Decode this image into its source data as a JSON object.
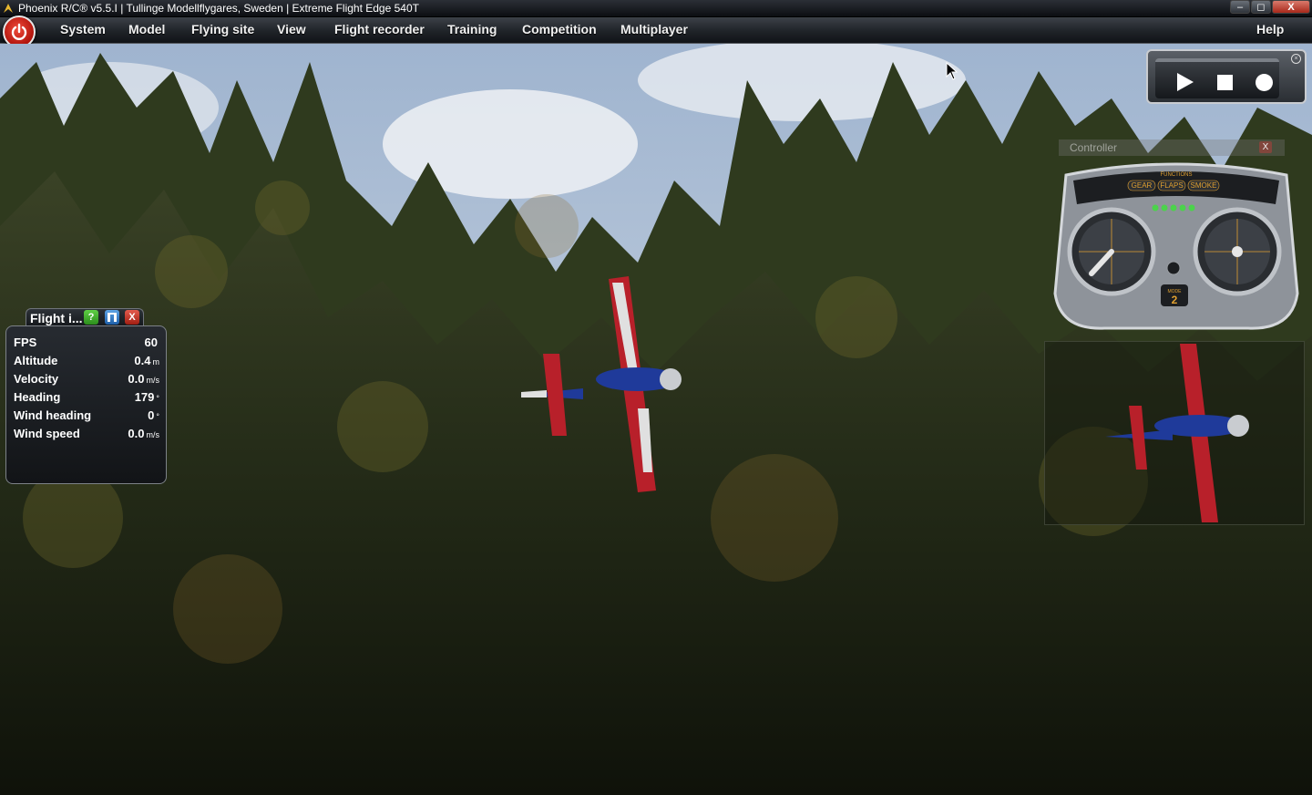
{
  "window": {
    "title": "Phoenix R/C® v5.5.I  |  Tullinge Modellflygares, Sweden  |  Extreme Flight Edge 540T",
    "controls": {
      "minimize": "–",
      "maximize": "◻",
      "close": "X"
    }
  },
  "menu": {
    "items": [
      "System",
      "Model",
      "Flying site",
      "View",
      "Flight recorder",
      "Training",
      "Competition",
      "Multiplayer"
    ],
    "help": "Help"
  },
  "recorder": {
    "icons": [
      "play-icon",
      "stop-icon",
      "record-icon"
    ]
  },
  "controller": {
    "title": "Controller",
    "close": "X",
    "functions_label": "FUNCTIONS",
    "function_buttons": [
      "GEAR",
      "FLAPS",
      "SMOKE"
    ],
    "mode_label": "MODE",
    "mode_value": "2"
  },
  "flight_info": {
    "title": "Flight i...",
    "help": "?",
    "close": "X",
    "rows": [
      {
        "label": "FPS",
        "value": "60",
        "unit": ""
      },
      {
        "label": "Altitude",
        "value": "0.4",
        "unit": "m"
      },
      {
        "label": "Velocity",
        "value": "0.0",
        "unit": "m/s"
      },
      {
        "label": "Heading",
        "value": "179",
        "unit": "°"
      },
      {
        "label": "Wind heading",
        "value": "0",
        "unit": "°"
      },
      {
        "label": "Wind speed",
        "value": "0.0",
        "unit": "m/s"
      }
    ]
  },
  "colors": {
    "aircraft_red": "#b8202a",
    "aircraft_blue": "#1f3a9a",
    "menu_bg": "#1f2328"
  }
}
